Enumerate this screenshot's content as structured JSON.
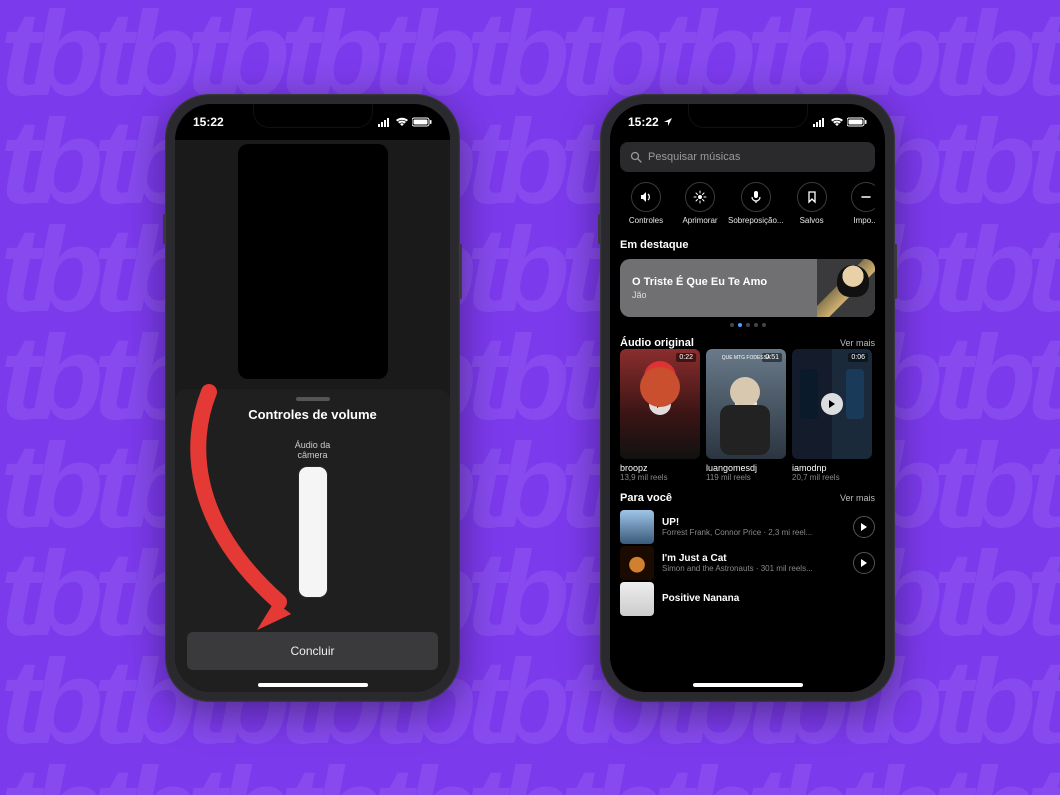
{
  "bg_pattern_text": "tbtbtbtbtbtbtbtbtbtbtbtb\ntbtbtbtbtbtbtbtbtbtbtbtb\ntbtbtbtbtbtbtbtbtbtbtbtb\ntbtbtbtbtbtbtbtbtbtbtbtb\ntbtbtbtbtbtbtbtbtbtbtbtb\ntbtbtbtbtbtbtbtbtbtbtbtb\ntbtbtbtbtbtbtbtbtbtbtbtb\ntbtbtbtbtbtbtbtbtbtbtbtb\ntbtbtbtbtbtbtbtbtbtbtbtb",
  "statusbar": {
    "time": "15:22"
  },
  "phone1": {
    "sheet_title": "Controles de volume",
    "slider_label_line1": "Áudio da",
    "slider_label_line2": "câmera",
    "bottom_glyph": "o",
    "done_button": "Concluir"
  },
  "phone2": {
    "search_placeholder": "Pesquisar músicas",
    "tools": [
      {
        "label": "Controles",
        "icon": "speaker"
      },
      {
        "label": "Aprimorar",
        "icon": "sparkle"
      },
      {
        "label": "Sobreposição...",
        "icon": "mic"
      },
      {
        "label": "Salvos",
        "icon": "bookmark"
      },
      {
        "label": "Impo...",
        "icon": "minus"
      }
    ],
    "featured_header": "Em destaque",
    "featured": {
      "title": "O Triste É Que Eu Te Amo",
      "artist": "Jão"
    },
    "dots_active_index": 1,
    "dots_count": 5,
    "original_header": "Áudio original",
    "see_more": "Ver mais",
    "original": [
      {
        "duration": "0:22",
        "name": "broopz",
        "sub": "13,9 mil reels"
      },
      {
        "duration": "0:51",
        "name": "luangomesdj",
        "sub": "119 mil reels",
        "caption": "QUE MTG FODESSA"
      },
      {
        "duration": "0:06",
        "name": "iamodnp",
        "sub": "20,7 mil reels"
      }
    ],
    "foryou_header": "Para você",
    "tracks": [
      {
        "title": "UP!",
        "sub": "Forrest Frank, Connor Price · 2,3 mi reel..."
      },
      {
        "title": "I'm Just a Cat",
        "sub": "Simon and the Astronauts · 301 mil reels..."
      },
      {
        "title": "Positive Nanana",
        "sub": ""
      }
    ]
  }
}
